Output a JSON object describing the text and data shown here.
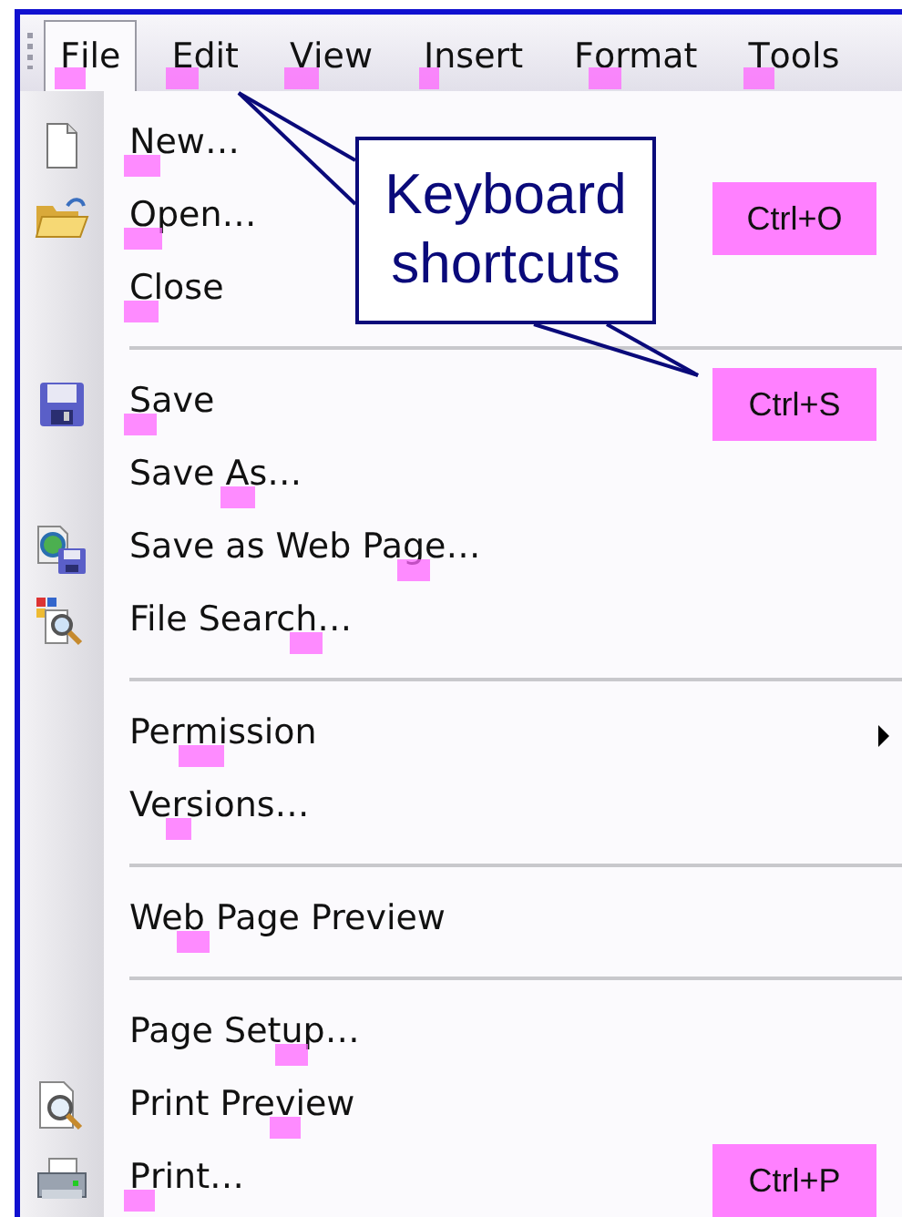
{
  "menubar": {
    "items": [
      {
        "key": "F",
        "post": "ile",
        "selected": true
      },
      {
        "key": "E",
        "post": "dit",
        "selected": false
      },
      {
        "key": "V",
        "post": "iew",
        "selected": false
      },
      {
        "key": "I",
        "post": "nsert",
        "selected": false
      },
      {
        "pre": "F",
        "key": "o",
        "post": "rmat",
        "selected": false
      },
      {
        "key": "T",
        "post": "ools",
        "selected": false
      }
    ]
  },
  "menu": {
    "items": [
      {
        "kind": "item",
        "key": "N",
        "post": "ew…",
        "submenu": false
      },
      {
        "kind": "item",
        "key": "O",
        "post": "pen…",
        "shortcut": "Ctrl+O",
        "submenu": false
      },
      {
        "kind": "item",
        "key": "C",
        "post": "lose",
        "submenu": false
      },
      {
        "kind": "separator"
      },
      {
        "kind": "item",
        "key": "S",
        "post": "ave",
        "shortcut": "Ctrl+S",
        "submenu": false
      },
      {
        "kind": "item",
        "pre": "Save ",
        "key": "A",
        "post": "s…",
        "submenu": false
      },
      {
        "kind": "item",
        "pre": "Save as Web Pa",
        "key": "g",
        "post": "e…",
        "submenu": false
      },
      {
        "kind": "item",
        "pre": "File Searc",
        "key": "h",
        "post": "…",
        "submenu": false
      },
      {
        "kind": "separator"
      },
      {
        "kind": "item",
        "pre": "Per",
        "key": "m",
        "post": "ission",
        "submenu": true
      },
      {
        "kind": "item",
        "pre": "Ve",
        "key": "r",
        "post": "sions…",
        "submenu": false
      },
      {
        "kind": "separator"
      },
      {
        "kind": "item",
        "pre": "We",
        "key": "b",
        "post": " Page Preview",
        "submenu": false
      },
      {
        "kind": "separator"
      },
      {
        "kind": "item",
        "pre": "Page Set",
        "key": "u",
        "post": "p…",
        "submenu": false
      },
      {
        "kind": "item",
        "pre": "Print Pre",
        "key": "v",
        "post": "iew",
        "submenu": false
      },
      {
        "kind": "item",
        "key": "P",
        "post": "rint…",
        "shortcut": "Ctrl+P",
        "submenu": false
      }
    ]
  },
  "callout": {
    "text": "Keyboard shortcuts"
  }
}
